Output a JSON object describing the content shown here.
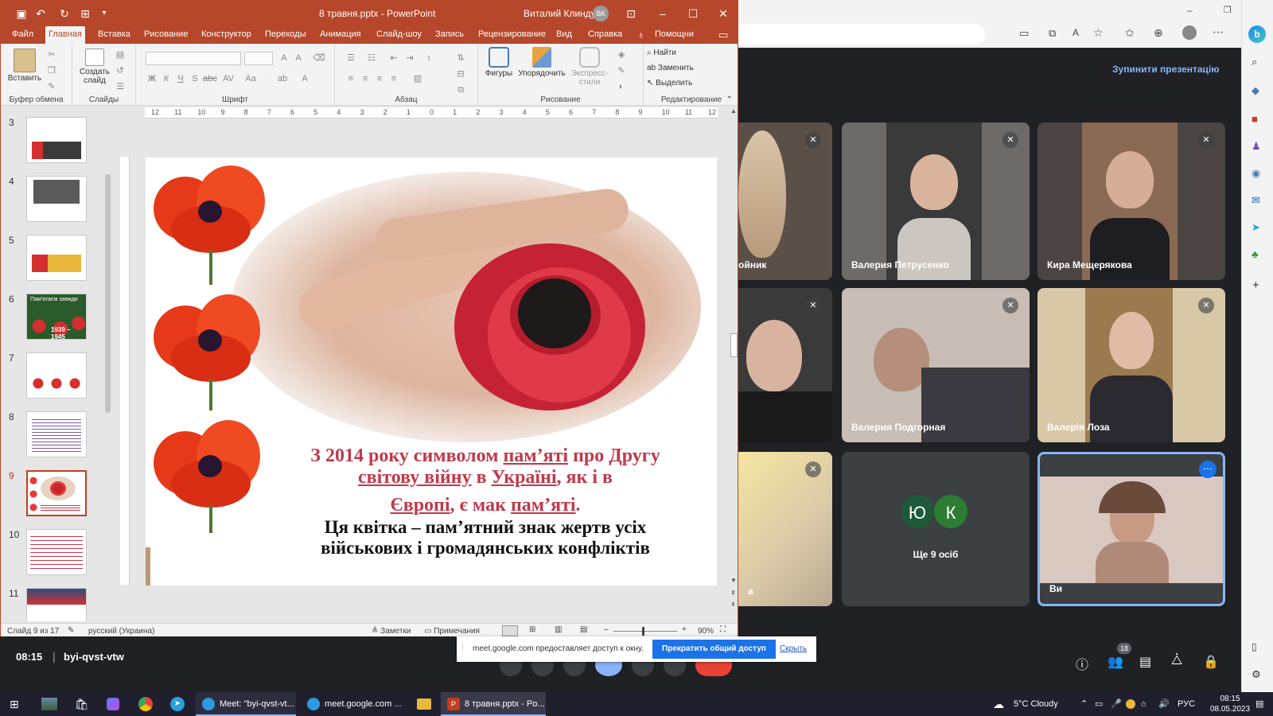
{
  "ppt": {
    "title": "8 травня.pptx - PowerPoint",
    "user": "Виталий Клиндух",
    "user_initials": "ВК",
    "tabs": [
      "Файл",
      "Главная",
      "Вставка",
      "Рисование",
      "Конструктор",
      "Переходы",
      "Анимация",
      "Слайд-шоу",
      "Запись",
      "Рецензирование",
      "Вид",
      "Справка"
    ],
    "tell_me": "Помощни",
    "ribbon": {
      "paste": "Вставить",
      "clipboard": "Буфер обмена",
      "new_slide_1": "Создать",
      "new_slide_2": "слайд",
      "slides": "Слайды",
      "font": "Шрифт",
      "paragraph": "Абзац",
      "shapes": "Фигуры",
      "arrange": "Упорядочить",
      "quick_styles_1": "Экспресс-",
      "quick_styles_2": "стили",
      "drawing": "Рисование",
      "find": "Найти",
      "replace": "Заменить",
      "select": "Выделить",
      "editing": "Редактирование"
    },
    "ruler_ticks": [
      "12",
      "11",
      "10",
      "9",
      "8",
      "7",
      "6",
      "5",
      "4",
      "3",
      "2",
      "1",
      "0",
      "1",
      "2",
      "3",
      "4",
      "5",
      "6",
      "7",
      "8",
      "9",
      "10",
      "11",
      "12"
    ],
    "thumb_numbers": [
      "3",
      "4",
      "5",
      "6",
      "7",
      "8",
      "9",
      "10",
      "11"
    ],
    "thumb6_text_1": "Пам'ятаєм завжди",
    "thumb6_text_2": "1939 – 1945",
    "slide": {
      "line1_a": "З 2014 року символом ",
      "line1_b": "пам’яті",
      "line1_c": " про Другу",
      "line2_a": "світову війну",
      "line2_b": " в ",
      "line2_c": "Україні",
      "line2_d": ", як і в",
      "line3_a": "Європі",
      "line3_b": ", є мак ",
      "line3_c": "пам’яті",
      "line3_d": ".",
      "line4": "Ця квітка – пам’ятний знак жертв усіх",
      "line5": "військових і громадянських конфліктів"
    },
    "status": {
      "slide": "Слайд 9 из 17",
      "lang": "русский (Украина)",
      "notes": "Заметки",
      "comments": "Примечания",
      "zoom": "90%"
    }
  },
  "meet": {
    "stop_presenting": "Зупинити презентацію",
    "participants": [
      {
        "name": "ойник"
      },
      {
        "name": "Валерия Петрусенко"
      },
      {
        "name": "Кира Мещерякова"
      },
      {
        "name": ""
      },
      {
        "name": "Валерия Подгорная"
      },
      {
        "name": "Валерія Лоза"
      },
      {
        "name": "а"
      },
      {
        "name": "Ще 9 осіб"
      },
      {
        "name": "Ви"
      }
    ],
    "avatar_1": "Ю",
    "avatar_2": "К",
    "time": "08:15",
    "code": "byi-qvst-vtw",
    "people_count": "18",
    "share_text": "meet.google.com предоставляет доступ к окну.",
    "share_stop": "Прекратить общий доступ",
    "share_hide": "Скрыть"
  },
  "taskbar": {
    "items": [
      "Meet: \"byi-qvst-vt...",
      "meet.google.com ...",
      "8 травня.pptx - Po..."
    ],
    "weather": "5°C  Cloudy",
    "lang": "РУС",
    "time": "08:15",
    "date": "08.05.2023"
  }
}
